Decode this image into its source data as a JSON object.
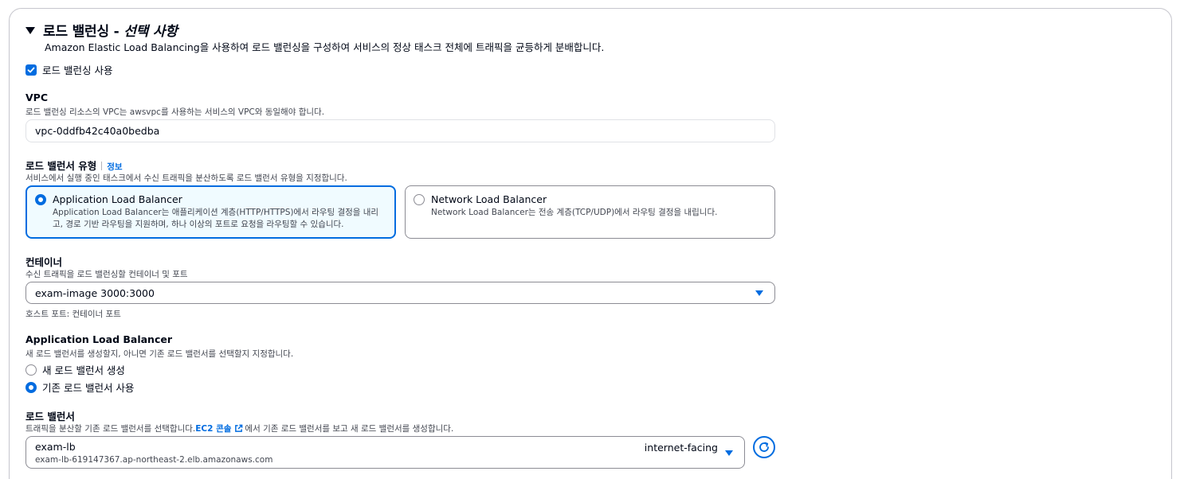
{
  "section": {
    "title_prefix": "로드 밸런싱 - ",
    "title_suffix": "선택 사항",
    "description": "Amazon Elastic Load Balancing을 사용하여 로드 밸런싱을 구성하여 서비스의 정상 태스크 전체에 트래픽을 균등하게 분배합니다.",
    "enable_label": "로드 밸런싱 사용",
    "enable_checked": true
  },
  "vpc": {
    "label": "VPC",
    "description": "로드 밸런싱 리소스의 VPC는 awsvpc를 사용하는 서비스의 VPC와 동일해야 합니다.",
    "value": "vpc-0ddfb42c40a0bedba"
  },
  "lb_type": {
    "label": "로드 밸런서 유형",
    "info": "정보",
    "description": "서비스에서 실행 중인 태스크에서 수신 트래픽을 분산하도록 로드 밸런서 유형을 지정합니다.",
    "options": [
      {
        "title": "Application Load Balancer",
        "description": "Application Load Balancer는 애플리케이션 계층(HTTP/HTTPS)에서 라우팅 결정을 내리고, 경로 기반 라우팅을 지원하며, 하나 이상의 포트로 요청을 라우팅할 수 있습니다.",
        "selected": true
      },
      {
        "title": "Network Load Balancer",
        "description": "Network Load Balancer는 전송 계층(TCP/UDP)에서 라우팅 결정을 내립니다.",
        "selected": false
      }
    ]
  },
  "container": {
    "label": "컨테이너",
    "description": "수신 트래픽을 로드 밸런싱할 컨테이너 및 포트",
    "value": "exam-image 3000:3000",
    "hint": "호스트 포트: 컨테이너 포트"
  },
  "alb": {
    "label": "Application Load Balancer",
    "description": "새 로드 밸런서를 생성할지, 아니면 기존 로드 밸런서를 선택할지 지정합니다.",
    "options": [
      {
        "label": "새 로드 밸런서 생성",
        "selected": false
      },
      {
        "label": "기존 로드 밸런서 사용",
        "selected": true
      }
    ]
  },
  "load_balancer": {
    "label": "로드 밸런서",
    "desc_before": "트래픽을 분산할 기존 로드 밸런서를 선택합니다. ",
    "link_text": "EC2 콘솔",
    "desc_after": "에서 기존 로드 밸런서를 보고 새 로드 밸런서를 생성합니다.",
    "selected_name": "exam-lb",
    "selected_dns": "exam-lb-619147367.ap-northeast-2.elb.amazonaws.com",
    "selected_scheme": "internet-facing"
  },
  "colors": {
    "accent": "#006ce0",
    "tile_selected_bg": "#f0fbff"
  }
}
